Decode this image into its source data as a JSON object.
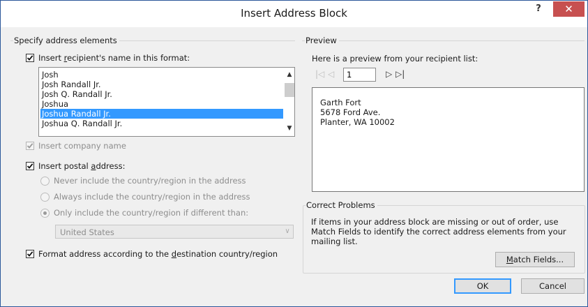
{
  "window": {
    "title": "Insert Address Block",
    "help_label": "?",
    "close_label": "✕"
  },
  "left": {
    "group_label": "Specify address elements",
    "recipient_name": {
      "label_pre": "Insert ",
      "label_accel": "r",
      "label_post": "ecipient's name in this format:",
      "checked": true,
      "formats": [
        "Josh",
        "Josh Randall Jr.",
        "Josh Q. Randall Jr.",
        "Joshua",
        "Joshua Randall Jr.",
        "Joshua Q. Randall Jr."
      ],
      "selected_index": 4
    },
    "company": {
      "label": "Insert company name",
      "checked": true,
      "disabled": true
    },
    "postal": {
      "label_pre": "Insert postal ",
      "label_accel": "a",
      "label_post": "ddress:",
      "checked": true,
      "options": [
        "Never include the country/region in the address",
        "Always include the country/region in the address",
        "Only include the country/region if different than:"
      ],
      "selected_option": 2,
      "country": "United States"
    },
    "format_dest": {
      "label_pre": "Format address according to the ",
      "label_accel": "d",
      "label_post": "estination country/region",
      "checked": true
    }
  },
  "preview": {
    "group_label": "Preview",
    "intro": "Here is a preview from your recipient list:",
    "record_number": "1",
    "address_lines": [
      "Garth Fort",
      "5678 Ford Ave.",
      "Planter, WA 10002"
    ]
  },
  "correct": {
    "group_label": "Correct Problems",
    "message": "If items in your address block are missing or out of order, use Match Fields to identify the correct address elements from your mailing list.",
    "match_pre": "",
    "match_accel": "M",
    "match_post": "atch Fields..."
  },
  "buttons": {
    "ok": "OK",
    "cancel": "Cancel"
  }
}
